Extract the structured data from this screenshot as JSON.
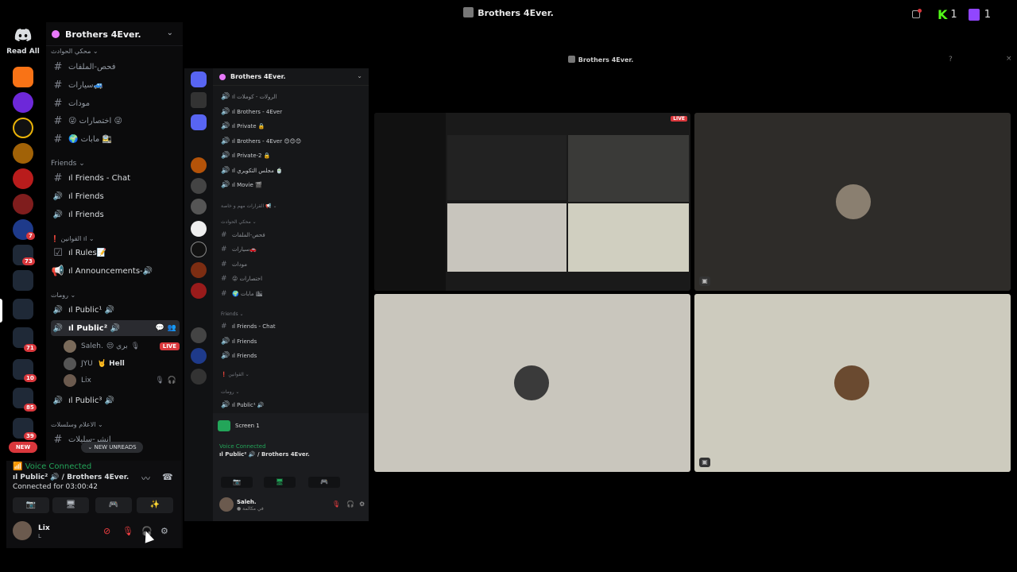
{
  "window": {
    "title": "Brothers 4Ever."
  },
  "tray": {
    "count_a": "1",
    "count_b": "1"
  },
  "rail": {
    "read_all": "Read All",
    "new_label": "NEW",
    "badges": [
      "7",
      "73",
      "71",
      "10",
      "85",
      "39"
    ]
  },
  "server": {
    "name": "Brothers 4Ever."
  },
  "sidebar": {
    "category_1": "محكي الحوادث ⌄",
    "channels_1": [
      "فحص-الملفات",
      "سيارات🚙",
      "مودات",
      "😜 اختصارات 😜",
      "🌍 مابات 🚉"
    ],
    "category_friends": "Friends ⌄",
    "friends_chat": "ıl Friends - Chat",
    "friends_voice_1": "ıl Friends",
    "friends_voice_2": "ıl Friends",
    "category_rules": "❗ القوانين ıl ⌄",
    "rules": "ıl Rules📝",
    "announcements": "ıl Announcements-🔊",
    "category_rooms": "رومات ⌄",
    "public_1": "ıl Public¹ 🔊",
    "public_2": "ıl Public² 🔊",
    "users": [
      {
        "name": "Saleh.",
        "extra": "😒 بري",
        "live": "LIVE"
      },
      {
        "name": "JYU",
        "extra": "🤘 Hell"
      },
      {
        "name": "Lix",
        "extra": ""
      }
    ],
    "public_3": "ıl Public³ 🔊",
    "category_last": "الاعلام وسلسلات ⌄",
    "last_channel": "انشر-سليلات",
    "new_unreads": "⌄ NEW UNREADS"
  },
  "voice": {
    "status": "Voice Connected",
    "channel": "ıl Public² 🔊 / Brothers 4Ever.",
    "timer": "Connected for 03:00:42"
  },
  "me": {
    "name": "Lix",
    "sub": "L"
  },
  "share": {
    "title": "Brothers 4Ever.",
    "server_name": "Brothers 4Ever.",
    "channels": [
      "ıl الرولات - كوملات",
      "ıl Brothers - 4Ever",
      "ıl Private 🔒",
      "ıl Brothers - 4Ever 😊😊😊",
      "ıl Private-2 🔒",
      "ıl مجلس التكويري 🍵",
      "ıl Movie 🎬"
    ],
    "cat_a": "القرارات مهم و خاصة 📢 ⌄",
    "cat_b": "محكي الحوادث ⌄",
    "channels_b": [
      "فحص-الملفات",
      "سيارات🚗",
      "مودات",
      "😜 اختصارات",
      "🌍 مابات 🏙"
    ],
    "cat_friends": "Friends ⌄",
    "friends": [
      "ıl Friends - Chat",
      "ıl Friends",
      "ıl Friends"
    ],
    "cat_rules": "❗ القوانين ⌄",
    "cat_rooms": "رومات ⌄",
    "public": "ıl Public¹ 🔊",
    "screen_label": "Screen 1",
    "vc_status": "Voice Connected",
    "vc_channel": "ıl Public² 🔊 / Brothers 4Ever.",
    "user_name": "Saleh.",
    "user_sub": "● في مكالمة",
    "live": "LIVE"
  },
  "colors": {
    "accent_green": "#23a559",
    "danger": "#da373c",
    "brand": "#5865f2"
  }
}
